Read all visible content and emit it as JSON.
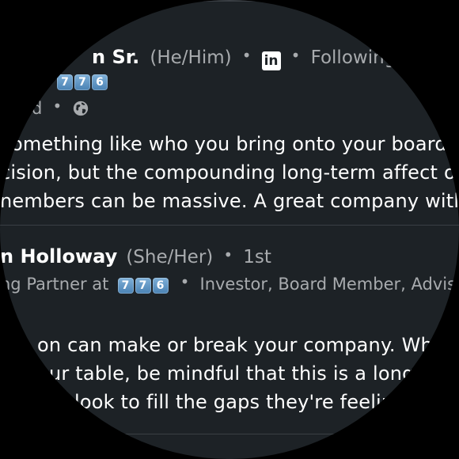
{
  "post1": {
    "author_name_fragment": "n Sr.",
    "pronouns": "(He/Him)",
    "linkedin_icon_text": "in",
    "follow_status": "Following",
    "keycaps": [
      "7",
      "7",
      "6"
    ],
    "meta_fragment": "d",
    "globe_icon": "globe-icon",
    "body_lines": [
      "omething like who you bring onto your board ca",
      "cision, but the compounding long-term affect of",
      "nembers can be massive. A great company with a"
    ]
  },
  "post2": {
    "author_name_fragment": "n Holloway",
    "pronouns": "(She/Her)",
    "connection_degree": "1st",
    "headline_prefix": "ng Partner at",
    "keycaps": [
      "7",
      "7",
      "6"
    ],
    "headline_suffix": "Investor, Board Member, Advisor,",
    "body_lines": [
      "on can make or break your company. When",
      "ur table, be mindful that this is a long-te",
      "look to fill the gaps they're feeling"
    ]
  },
  "separator": "•",
  "colors": {
    "background": "#1d2226",
    "text_primary": "#ffffff",
    "text_secondary": "#a8abae",
    "keycap": "#5b93c4"
  }
}
